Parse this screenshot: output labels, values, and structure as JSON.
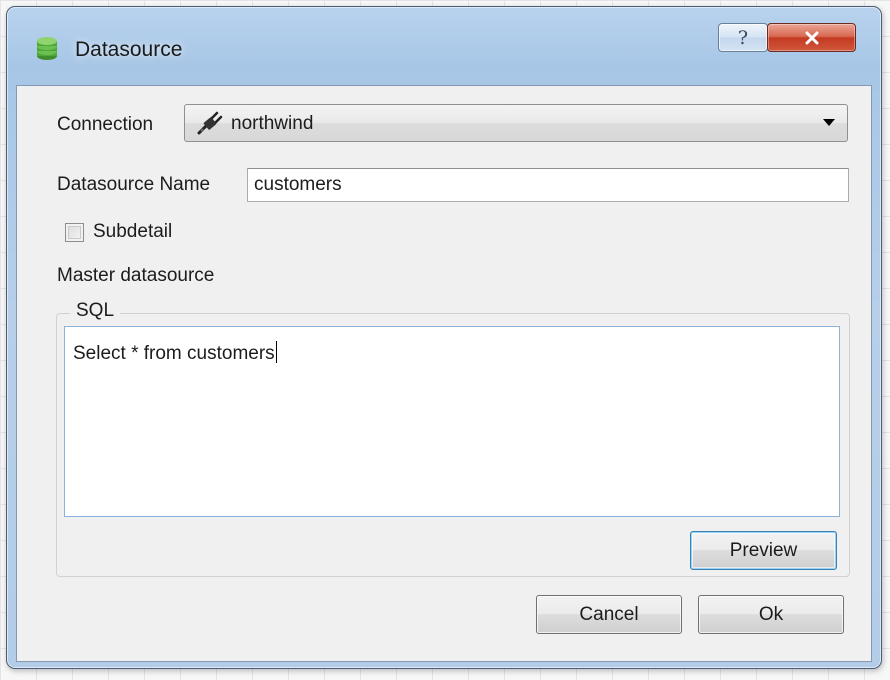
{
  "window": {
    "title": "Datasource",
    "help_glyph": "?",
    "close_icon": "close-x-icon"
  },
  "form": {
    "connection_label": "Connection",
    "connection_value": "northwind",
    "datasource_name_label": "Datasource Name",
    "datasource_name_value": "customers",
    "subdetail_label": "Subdetail",
    "subdetail_checked": false,
    "master_datasource_label": "Master datasource"
  },
  "sql": {
    "group_title": "SQL",
    "query": "Select * from customers",
    "preview_label": "Preview"
  },
  "buttons": {
    "cancel": "Cancel",
    "ok": "Ok"
  },
  "colors": {
    "window_frame": "#b3cce7",
    "close_button": "#c43b22",
    "focus_border": "#3c7fb1"
  }
}
